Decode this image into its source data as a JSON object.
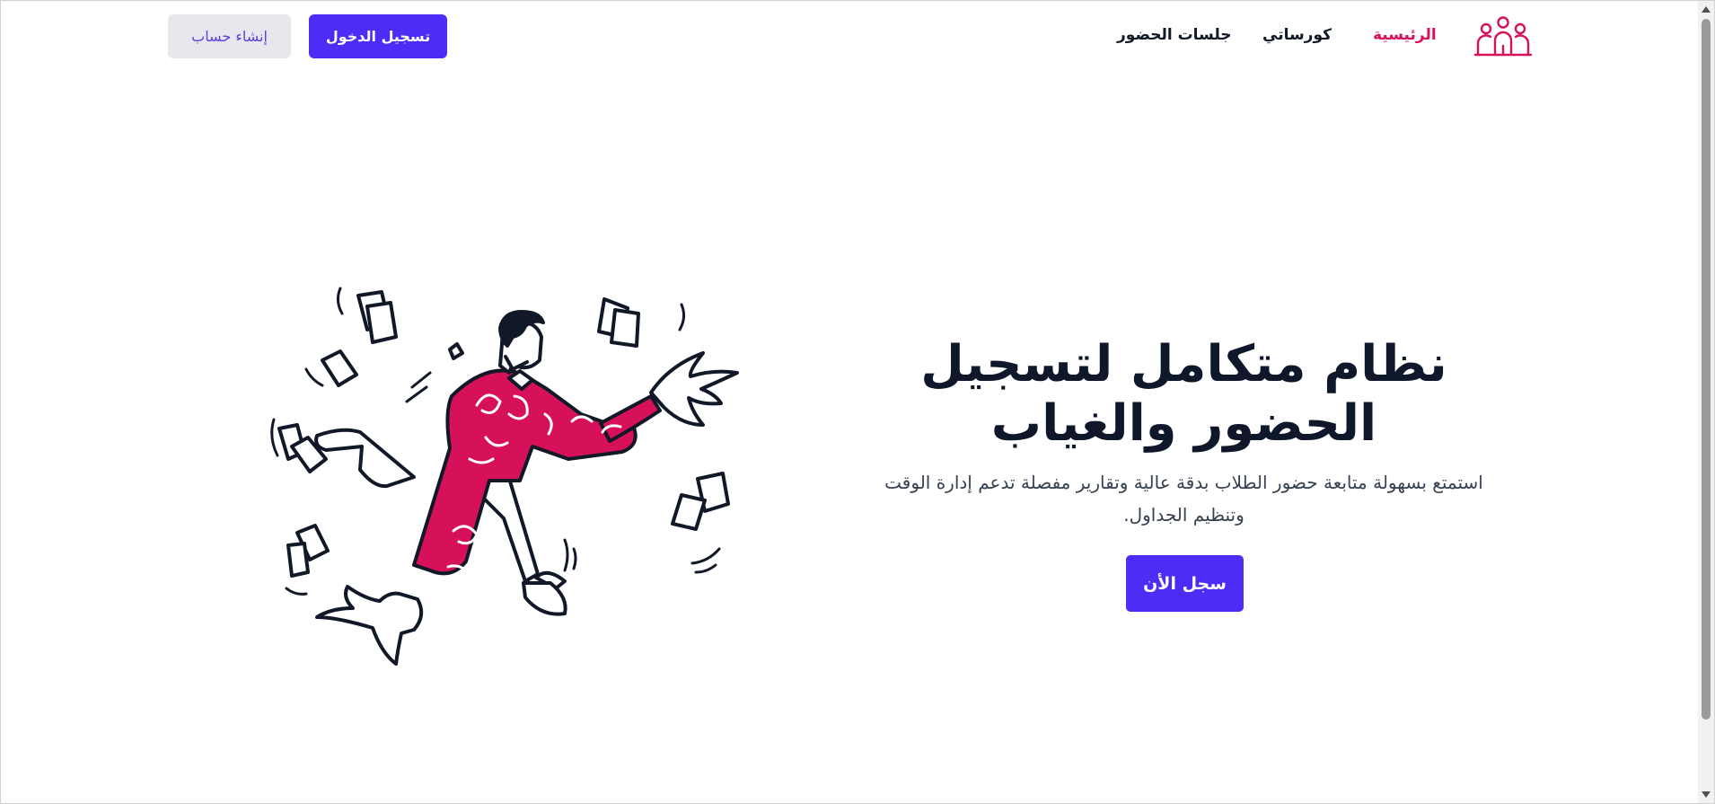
{
  "header": {
    "logo_icon": "people-group-icon",
    "nav": {
      "home": "الرئيسية",
      "courses": "كورساتي",
      "sessions": "جلسات الحضور"
    },
    "buttons": {
      "login": "تسجيل الدخول",
      "register": "إنشاء حساب"
    }
  },
  "hero": {
    "title": "نظام متكامل لتسجيل الحضور والغياب",
    "description": "استمتع بسهولة متابعة حضور الطلاب بدقة عالية وتقارير مفصلة تدعم إدارة الوقت وتنظيم الجداول.",
    "cta": "سجل الأن",
    "illustration": "person-juggling-papers-illustration"
  },
  "colors": {
    "accent": "#4f2cf5",
    "brand": "#d6115a",
    "text": "#0f172a"
  }
}
